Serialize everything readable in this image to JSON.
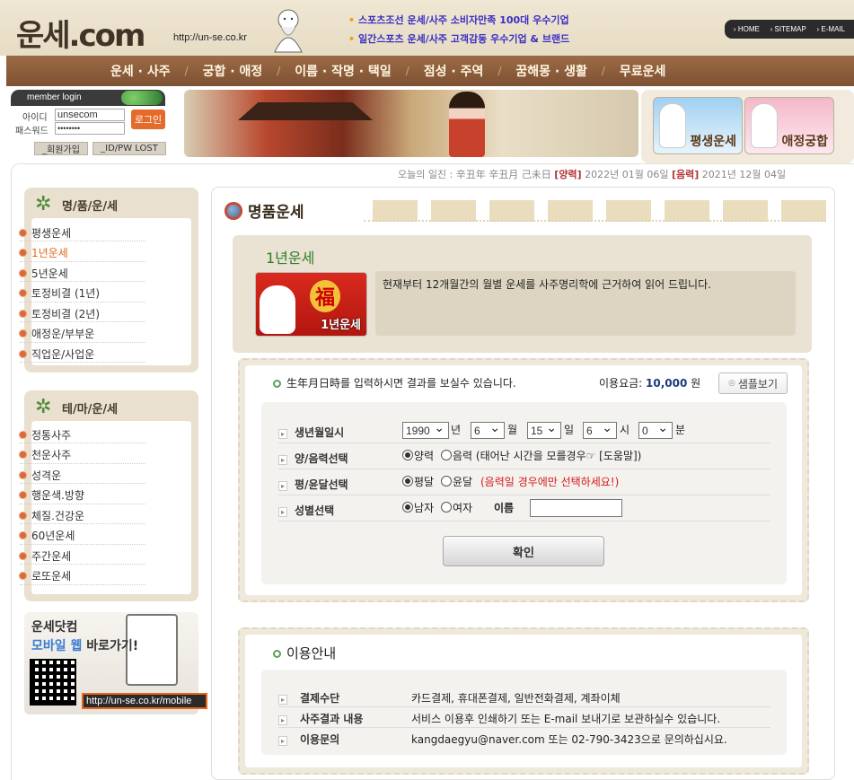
{
  "header": {
    "logo": "운세.com",
    "url": "http://un-se.co.kr",
    "notices": [
      "스포츠조선 운세/사주 소비자만족 100대 우수기업",
      "일간스포츠 운세/사주 고객감동 우수기업 & 브랜드"
    ],
    "top_links": [
      "HOME",
      "SITEMAP",
      "E-MAIL"
    ]
  },
  "nav": [
    "운세 · 사주",
    "궁합 · 애정",
    "이름 · 작명 · 택일",
    "점성 · 주역",
    "꿈해몽 · 생활",
    "무료운세"
  ],
  "login": {
    "title": "member login",
    "id_label": "아이디",
    "pw_label": "패스워드",
    "id_value": "unsecom",
    "pw_value": "••••••••",
    "login_button": "로그인",
    "join_button": "_회원가입",
    "lost_button": "_ID/PW LOST"
  },
  "right_banners": [
    "평생운세",
    "애정궁합"
  ],
  "dateline": {
    "prefix": "오늘의 일진 : 辛丑年 辛丑月 己未日",
    "solar_label": "[양력]",
    "solar": "2022년 01월 06일",
    "lunar_label": "[음력]",
    "lunar": "2021년 12월 04일"
  },
  "sidebar": {
    "box1_title": "명/품/운/세",
    "box1_items": [
      "평생운세",
      "1년운세",
      "5년운세",
      "토정비결 (1년)",
      "토정비결 (2년)",
      "애정운/부부운",
      "직업운/사업운"
    ],
    "box1_active": 1,
    "box2_title": "테/마/운/세",
    "box2_items": [
      "정통사주",
      "천운사주",
      "성격운",
      "행운색.방향",
      "체질.건강운",
      "60년운세",
      "주간운세",
      "로또운세"
    ],
    "mobile_line1": "운세닷컴",
    "mobile_line2a": "모바일 웹",
    "mobile_line2b": " 바로가기!",
    "mobile_url": "http://un-se.co.kr/mobile"
  },
  "main": {
    "title": "명품운세",
    "intro_title": "1년운세",
    "intro_image_label": "1년운세",
    "intro_image_char": "福",
    "intro_text": "현재부터 12개월간의 월별 운세를 사주명리학에 근거하여 읽어 드립니다."
  },
  "form": {
    "head": "生年月日時를 입력하시면 결과를 보실수 있습니다.",
    "fee_label": "이용요금: ",
    "fee_value": "10,000",
    "fee_unit": " 원",
    "sample_button": "샘플보기",
    "birth_label": "생년월일시",
    "year": "1990",
    "year_unit": "년",
    "month": "6",
    "month_unit": "월",
    "day": "15",
    "day_unit": "일",
    "hour": "6",
    "hour_unit": "시",
    "minute": "0",
    "minute_unit": "분",
    "calendar_label": "양/음력선택",
    "solar_option": "양력",
    "lunar_option": "음력 (태어난 시간을 모를경우☞ [도움말])",
    "leap_label": "평/윤달선택",
    "normal_option": "평달",
    "leap_option": "윤달",
    "leap_note": "(음력일 경우에만 선택하세요!)",
    "gender_label": "성별선택",
    "male_option": "남자",
    "female_option": "여자",
    "name_label": "이름",
    "name_value": "",
    "submit": "확인"
  },
  "guide": {
    "title": "이용안내",
    "rows": [
      {
        "label": "결제수단",
        "value": "카드결제, 휴대폰결제, 일반전화결제, 계좌이체"
      },
      {
        "label": "사주결과 내용",
        "value": "서비스 이용후 인쇄하기 또는 E-mail 보내기로 보관하실수 있습니다."
      },
      {
        "label": "이용문의",
        "value": "kangdaegyu@naver.com 또는 02-790-3423으로 문의하십시요."
      }
    ]
  },
  "colors": {
    "nav_bg": "#8a5c3c",
    "accent_orange": "#e06a1a",
    "green": "#2e7d27",
    "red": "#d21a1a"
  }
}
